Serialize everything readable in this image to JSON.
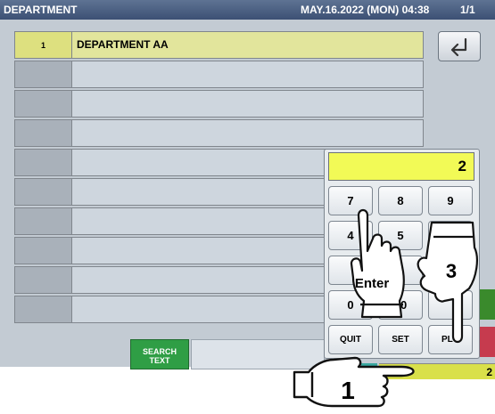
{
  "header": {
    "title": "DEPARTMENT",
    "datetime": "MAY.16.2022 (MON) 04:38",
    "page": "1/1"
  },
  "list": {
    "rows": [
      {
        "num": "1",
        "name": "DEPARTMENT AA",
        "selected": true
      },
      {
        "num": "",
        "name": ""
      },
      {
        "num": "",
        "name": ""
      },
      {
        "num": "",
        "name": ""
      },
      {
        "num": "",
        "name": ""
      },
      {
        "num": "",
        "name": ""
      },
      {
        "num": "",
        "name": ""
      },
      {
        "num": "",
        "name": ""
      },
      {
        "num": "",
        "name": ""
      },
      {
        "num": "",
        "name": ""
      }
    ]
  },
  "search_button": {
    "line1": "SEARCH",
    "line2": "TEXT"
  },
  "bottom_field": {
    "value": "2"
  },
  "keypad": {
    "display": "2",
    "keys": [
      "7",
      "8",
      "9",
      "4",
      "5",
      "",
      "",
      "",
      "0",
      "00",
      "",
      "QUIT",
      "SET",
      "PLU"
    ]
  },
  "overlay": {
    "enter_label": "Enter",
    "step1": "1",
    "step3": "3"
  },
  "icons": {
    "back": "back-arrow-icon"
  }
}
